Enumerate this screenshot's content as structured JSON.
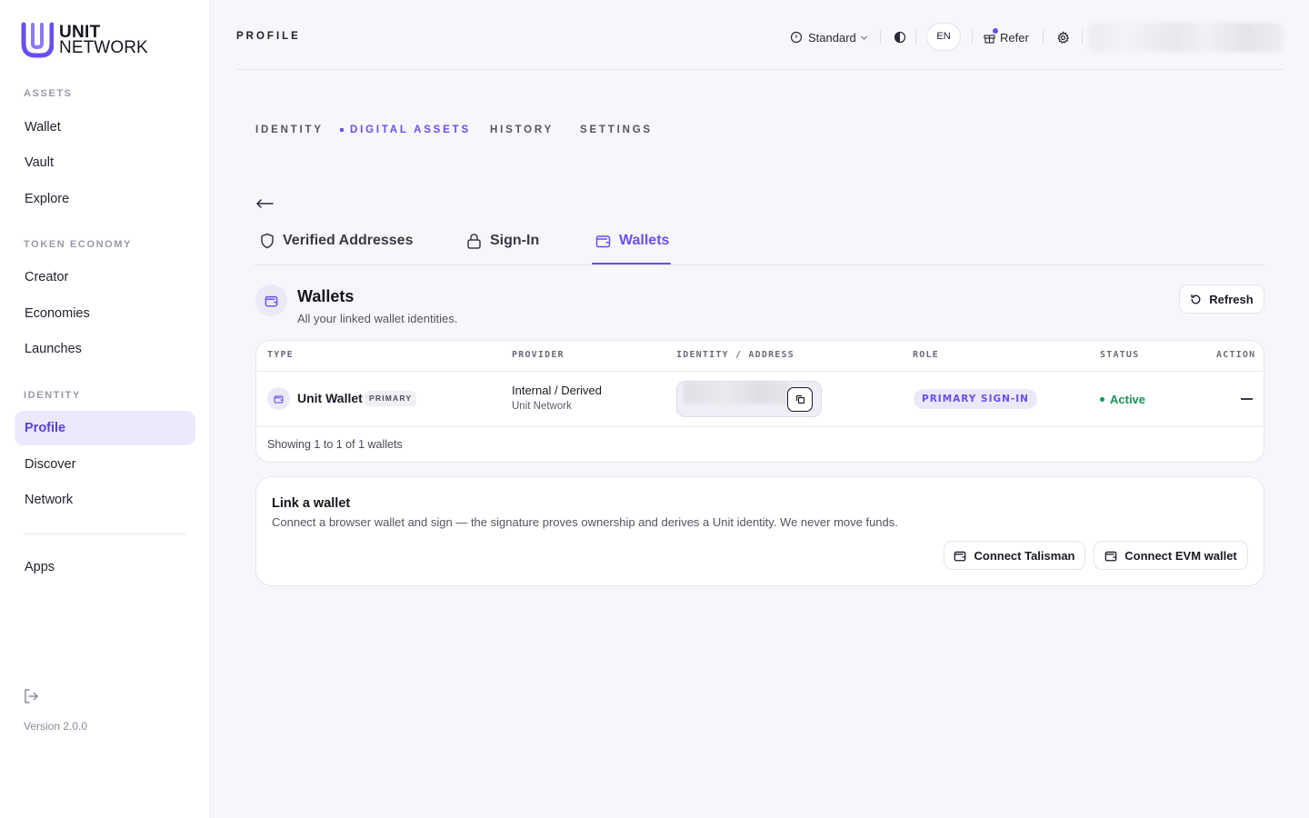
{
  "brand": {
    "line1": "UNIT",
    "line2": "NETWORK"
  },
  "sidebar": {
    "sections": [
      {
        "title": "ASSETS",
        "items": [
          "Wallet",
          "Vault",
          "Explore"
        ]
      },
      {
        "title": "TOKEN ECONOMY",
        "items": [
          "Creator",
          "Economies",
          "Launches"
        ]
      },
      {
        "title": "IDENTITY",
        "items": [
          "Profile",
          "Discover",
          "Network"
        ]
      }
    ],
    "extra": "Apps",
    "active": "Profile",
    "version": "Version 2.0.0"
  },
  "header": {
    "title": "PROFILE",
    "mode": "Standard",
    "language": "EN",
    "refer": "Refer"
  },
  "top_tabs": [
    "IDENTITY",
    "DIGITAL ASSETS",
    "HISTORY",
    "SETTINGS"
  ],
  "top_tab_active": "DIGITAL ASSETS",
  "sub_tabs": [
    "Verified Addresses",
    "Sign-In",
    "Wallets"
  ],
  "sub_tab_active": "Wallets",
  "section": {
    "title": "Wallets",
    "subtitle": "All your linked wallet identities.",
    "refresh": "Refresh"
  },
  "table": {
    "columns": [
      "TYPE",
      "PROVIDER",
      "IDENTITY / ADDRESS",
      "ROLE",
      "STATUS",
      "ACTION"
    ],
    "rows": [
      {
        "type": "Unit Wallet",
        "type_badge": "PRIMARY",
        "provider": "Internal / Derived",
        "provider_sub": "Unit Network",
        "role": "PRIMARY SIGN-IN",
        "status": "Active",
        "action": "—"
      }
    ],
    "footer": "Showing 1 to 1 of 1 wallets"
  },
  "link_wallet": {
    "title": "Link a wallet",
    "description": "Connect a browser wallet and sign — the signature proves ownership and derives a Unit identity. We never move funds.",
    "buttons": [
      "Connect Talisman",
      "Connect EVM wallet"
    ]
  },
  "colors": {
    "accent": "#6a4ef0",
    "active_bg": "#ece9fd",
    "status_active": "#17925a"
  }
}
